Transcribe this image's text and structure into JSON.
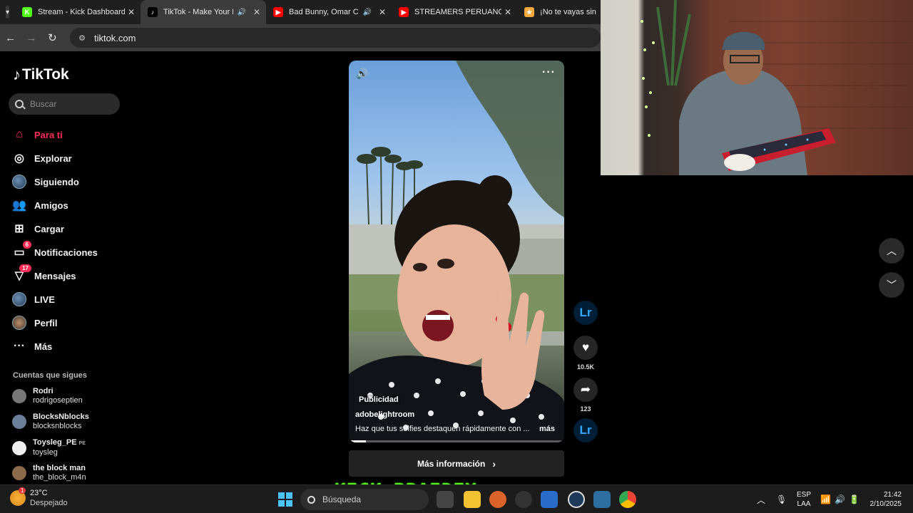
{
  "browser": {
    "tabs": [
      {
        "title": "Stream - Kick Dashboard",
        "favicon": "K",
        "fav_color": "#53fc18",
        "active": false,
        "audio": false
      },
      {
        "title": "TikTok - Make Your Day",
        "favicon": "♪",
        "fav_color": "#000000",
        "active": true,
        "audio": true
      },
      {
        "title": "Bad Bunny, Omar Courtz",
        "favicon": "▶",
        "fav_color": "#ff0000",
        "active": false,
        "audio": true
      },
      {
        "title": "STREAMERS PERUANOS qu",
        "favicon": "▶",
        "fav_color": "#ff0000",
        "active": false,
        "audio": false
      },
      {
        "title": "¡No te vayas sin",
        "favicon": "★",
        "fav_color": "#f2a93b",
        "active": false,
        "audio": false
      }
    ],
    "url": "tiktok.com"
  },
  "sidebar": {
    "logo": "TikTok",
    "search_placeholder": "Buscar",
    "nav": [
      {
        "label": "Para ti",
        "icon": "home-icon",
        "active": true
      },
      {
        "label": "Explorar",
        "icon": "compass-icon",
        "active": false
      },
      {
        "label": "Siguiendo",
        "icon": "following-avatar-icon",
        "active": false
      },
      {
        "label": "Amigos",
        "icon": "friends-icon",
        "active": false
      },
      {
        "label": "Cargar",
        "icon": "upload-icon",
        "active": false
      },
      {
        "label": "Notificaciones",
        "icon": "inbox-icon",
        "active": false,
        "badge": "6"
      },
      {
        "label": "Mensajes",
        "icon": "send-icon",
        "active": false,
        "badge": "17"
      },
      {
        "label": "LIVE",
        "icon": "live-icon",
        "active": false
      },
      {
        "label": "Perfil",
        "icon": "profile-avatar-icon",
        "active": false
      },
      {
        "label": "Más",
        "icon": "more-icon",
        "active": false
      }
    ],
    "following_title": "Cuentas que sigues",
    "following": [
      {
        "name": "Rodri",
        "handle": "rodrigoseptien"
      },
      {
        "name": "BlocksNblocks",
        "handle": "blocksnblocks"
      },
      {
        "name": "Toysleg_PE",
        "handle": "toysleg",
        "flag": "PE"
      },
      {
        "name": "the block man",
        "handle": "the_block_m4n"
      }
    ]
  },
  "video": {
    "label": "Publicidad",
    "username": "adobelightroom",
    "description": "Haz que tus selfies destaquen rápidamente con ...",
    "more": "más",
    "cta": "Más información",
    "progress": 0.08
  },
  "actions": {
    "likes": "10.5K",
    "shares": "123",
    "brand_icon": "Lr"
  },
  "overlay": {
    "kick_text": "KICK:BRAIDEX"
  },
  "taskbar": {
    "temp": "23°C",
    "weather": "Despejado",
    "weather_badge": "1",
    "search_placeholder": "Búsqueda",
    "lang_top": "ESP",
    "lang_bottom": "LAA",
    "time": "21:42",
    "date": "2/10/2025"
  }
}
